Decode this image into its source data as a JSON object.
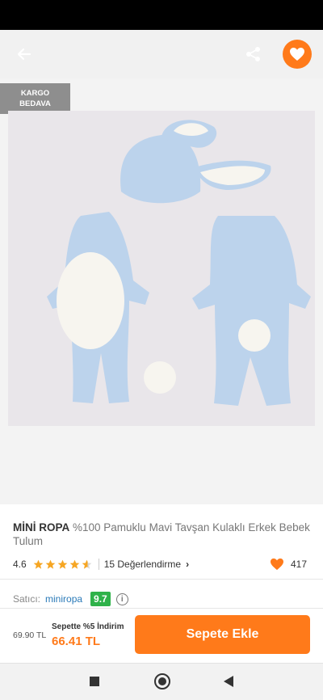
{
  "header": {
    "back_icon": "arrow-left-icon",
    "share_icon": "share-icon",
    "favorite_icon": "heart-icon",
    "accent_color": "#ff7a1a"
  },
  "gallery": {
    "badge_line1": "KARGO",
    "badge_line2": "BEDAVA"
  },
  "product": {
    "brand": "MİNİ ROPA",
    "title": "%100 Pamuklu Mavi Tavşan Kulaklı Erkek Bebek Tulum",
    "rating_value": "4.6",
    "rating_stars": 4.6,
    "reviews_text": "15 Değerlendirme",
    "likes": "417"
  },
  "seller": {
    "label": "Satıcı:",
    "name": "miniropa",
    "score": "9.7",
    "score_color": "#2fb24a"
  },
  "pricing": {
    "old_price": "69.90 TL",
    "discount_label": "Sepette %5 İndirim",
    "new_price": "66.41 TL",
    "cta_label": "Sepete Ekle"
  },
  "navbar": {
    "recent_icon": "square-icon",
    "home_icon": "circle-home-icon",
    "back_icon": "triangle-back-icon"
  }
}
